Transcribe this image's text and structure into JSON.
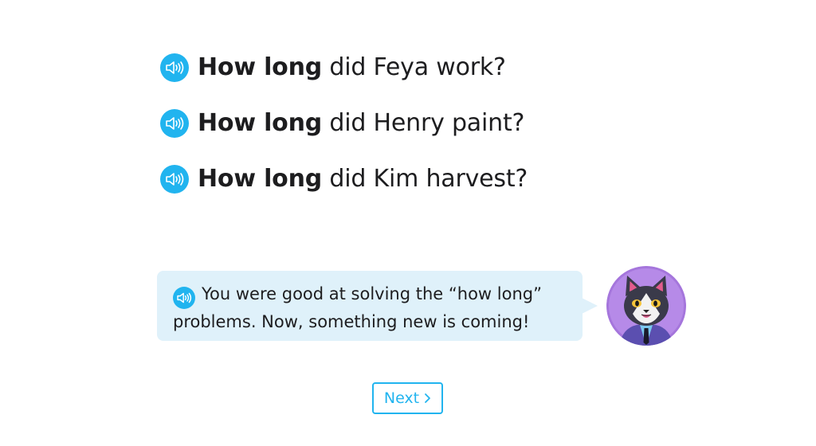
{
  "questions": [
    {
      "bold": "How long",
      "rest": " did Feya work?"
    },
    {
      "bold": "How long",
      "rest": " did Henry paint?"
    },
    {
      "bold": "How long",
      "rest": " did Kim harvest?"
    }
  ],
  "speech_bubble": {
    "text": "You were good at solving the “how long” problems. Now, something new is coming!"
  },
  "next_button": {
    "label": "Next",
    "icon": "chevron-right-icon"
  },
  "icons": {
    "speaker": "speaker-icon",
    "avatar": "cat-mascot-avatar"
  },
  "colors": {
    "accent": "#21b4ef",
    "bubble_bg": "#dff1fa",
    "avatar_bg": "#b68ae8"
  }
}
